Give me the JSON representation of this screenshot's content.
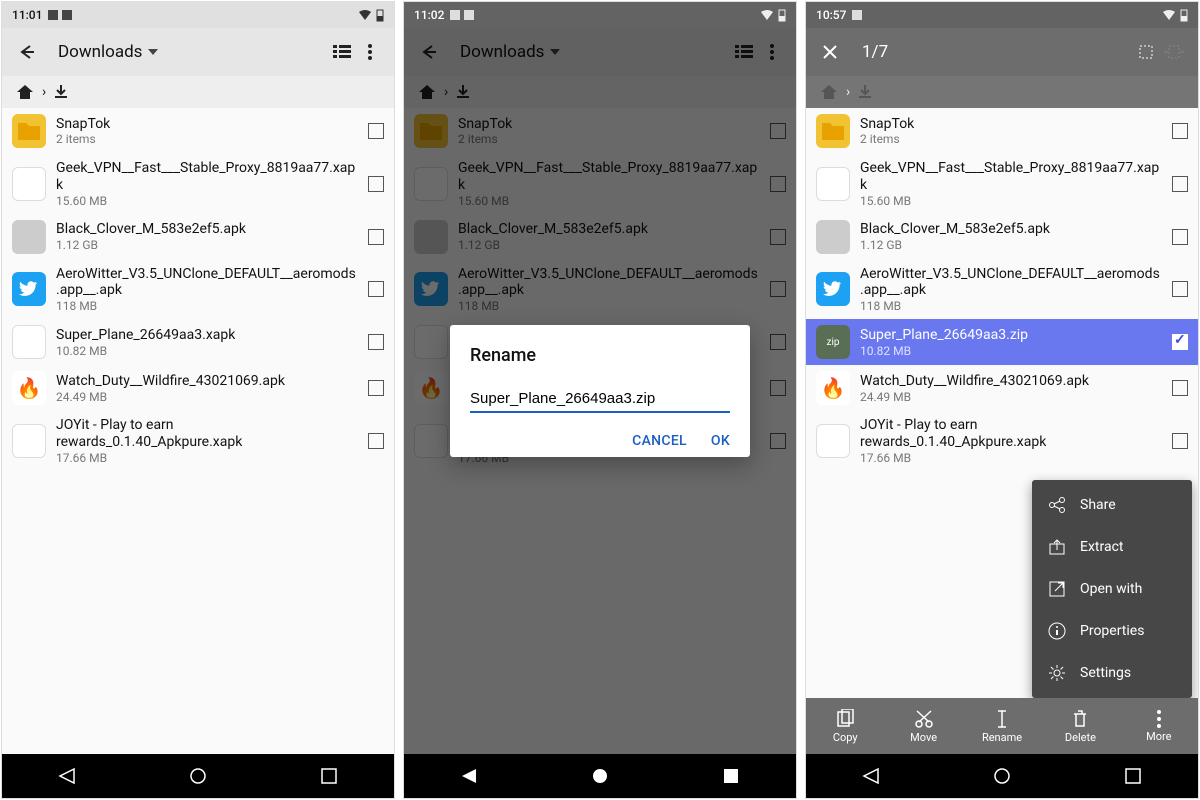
{
  "screens": {
    "a": {
      "time": "11:01",
      "title": "Downloads"
    },
    "b": {
      "time": "11:02",
      "title": "Downloads"
    },
    "c": {
      "time": "10:57",
      "selection": "1/7"
    }
  },
  "files": [
    {
      "name": "SnapTok",
      "sub": "2 items",
      "icon": "folder"
    },
    {
      "name": "Geek_VPN__Fast___Stable_Proxy_8819aa77.xapk",
      "sub": "15.60 MB",
      "icon": "blank"
    },
    {
      "name": "Black_Clover_M_583e2ef5.apk",
      "sub": "1.12 GB",
      "icon": "img"
    },
    {
      "name": "AeroWitter_V3.5_UNClone_DEFAULT__aeromods.app__.apk",
      "sub": "118 MB",
      "icon": "twitter"
    },
    {
      "name": "Super_Plane_26649aa3.xapk",
      "sub": "10.82 MB",
      "icon": "blank"
    },
    {
      "name": "Watch_Duty__Wildfire_43021069.apk",
      "sub": "24.49 MB",
      "icon": "fire"
    },
    {
      "name": "JOYit - Play to earn rewards_0.1.40_Apkpure.xapk",
      "sub": "17.66 MB",
      "icon": "blank"
    }
  ],
  "files_c_override": {
    "4": {
      "name": "Super_Plane_26649aa3.zip",
      "icon": "zip"
    }
  },
  "dialog": {
    "title": "Rename",
    "value": "Super_Plane_26649aa3.zip",
    "cancel": "CANCEL",
    "ok": "OK"
  },
  "actions": [
    {
      "icon": "copy",
      "label": "Copy"
    },
    {
      "icon": "cut",
      "label": "Move"
    },
    {
      "icon": "rename",
      "label": "Rename"
    },
    {
      "icon": "delete",
      "label": "Delete"
    },
    {
      "icon": "more",
      "label": "More"
    }
  ],
  "popup": [
    {
      "icon": "share",
      "label": "Share"
    },
    {
      "icon": "extract",
      "label": "Extract"
    },
    {
      "icon": "open",
      "label": "Open with"
    },
    {
      "icon": "info",
      "label": "Properties"
    },
    {
      "icon": "settings",
      "label": "Settings"
    }
  ]
}
